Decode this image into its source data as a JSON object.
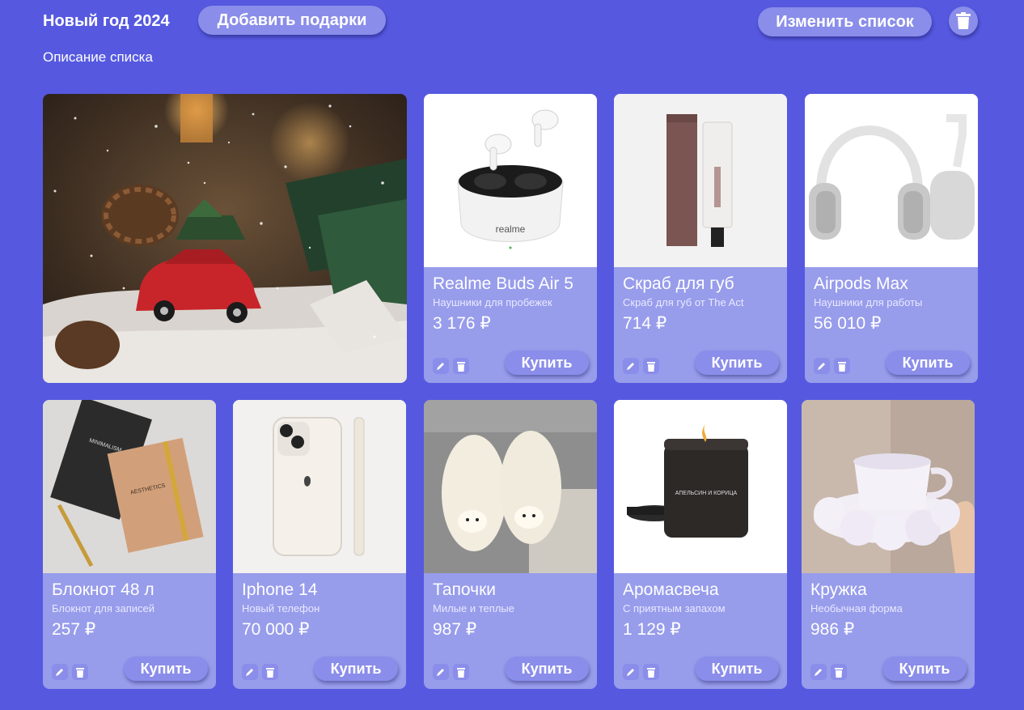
{
  "header": {
    "title": "Новый год 2024",
    "add_gifts_label": "Добавить подарки",
    "edit_list_label": "Изменить список",
    "description": "Описание списка"
  },
  "colors": {
    "background": "#5659e0",
    "button": "#8a8de9",
    "card": "#979ceb"
  },
  "gifts": [
    {
      "name": "Realme Buds Air 5",
      "description": "Наушники для пробежек",
      "price": "3 176 ₽",
      "buy_label": "Купить",
      "image": "earbuds"
    },
    {
      "name": "Скраб для губ",
      "description": "Скраб для губ от The Act",
      "price": "714 ₽",
      "buy_label": "Купить",
      "image": "lip-scrub"
    },
    {
      "name": "Airpods Max",
      "description": "Наушники для работы",
      "price": "56 010 ₽",
      "buy_label": "Купить",
      "image": "headphones"
    },
    {
      "name": "Блокнот 48 л",
      "description": "Блокнот для записей",
      "price": "257 ₽",
      "buy_label": "Купить",
      "image": "notebooks"
    },
    {
      "name": "Iphone 14",
      "description": "Новый телефон",
      "price": "70 000 ₽",
      "buy_label": "Купить",
      "image": "iphone"
    },
    {
      "name": "Тапочки",
      "description": "Милые и теплые",
      "price": "987 ₽",
      "buy_label": "Купить",
      "image": "slippers"
    },
    {
      "name": "Аромасвеча",
      "description": "С приятным запахом",
      "price": "1 129 ₽",
      "buy_label": "Купить",
      "image": "candle"
    },
    {
      "name": "Кружка",
      "description": "Необычная форма",
      "price": "986 ₽",
      "buy_label": "Купить",
      "image": "mug"
    }
  ],
  "image_texts": {
    "earbuds_brand": "realme",
    "notebook_1": "MINIMALISM",
    "notebook_2": "AESTHETICS",
    "candle_label": "АПЕЛЬСИН И КОРИЦА"
  }
}
